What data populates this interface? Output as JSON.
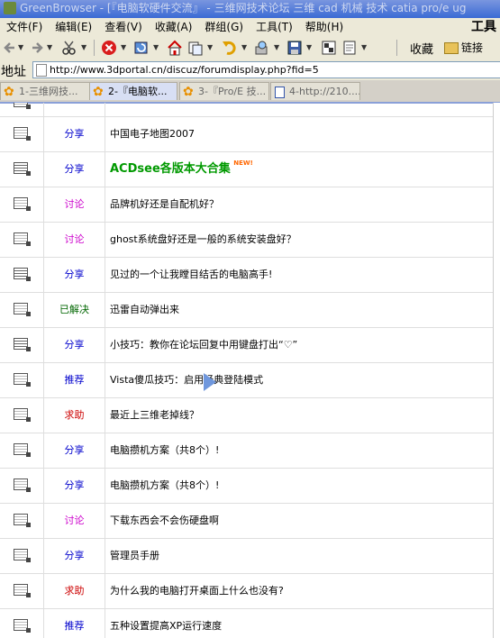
{
  "window": {
    "title": "GreenBrowser - [『电脑软硬件交流』 - 三维网技术论坛 三维 cad 机械 技术 catia pro/e ug"
  },
  "menu": {
    "items": [
      "文件(F)",
      "编辑(E)",
      "查看(V)",
      "收藏(A)",
      "群组(G)",
      "工具(T)",
      "帮助(H)"
    ],
    "tools_label": "工具"
  },
  "toolbar": {
    "favorites_label": "收藏",
    "links_label": "链接"
  },
  "address": {
    "label": "地址",
    "url": "http://www.3dportal.cn/discuz/forumdisplay.php?fid=5"
  },
  "tabs": [
    {
      "label": "1-三维网技...",
      "active": false,
      "icon": "flower-icon"
    },
    {
      "label": "2-『电脑软...",
      "active": true,
      "icon": "flower-icon"
    },
    {
      "label": "3-『Pro/E 技...",
      "active": false,
      "icon": "flower-icon"
    },
    {
      "label": "4-http://210....",
      "active": false,
      "icon": "page-icon"
    }
  ],
  "threads": [
    {
      "category": "分享",
      "cat": "share",
      "title": "中国电子地图2007",
      "icon": "doc-icon"
    },
    {
      "category": "分享",
      "cat": "share",
      "title": "ACDsee各版本大合集",
      "icon": "hot-doc-icon",
      "highlight": true,
      "badge": "NEW!"
    },
    {
      "category": "讨论",
      "cat": "discuss",
      "title": "品牌机好还是自配机好？",
      "icon": "doc-icon"
    },
    {
      "category": "讨论",
      "cat": "discuss",
      "title": "ghost系统盘好还是一般的系统安装盘好？",
      "icon": "doc-icon"
    },
    {
      "category": "分享",
      "cat": "share",
      "title": "见过的一个让我瞠目结舌的电脑高手!",
      "icon": "hot-doc-icon"
    },
    {
      "category": "已解决",
      "cat": "solved",
      "title": "迅雷自动弹出来",
      "icon": "doc-icon"
    },
    {
      "category": "分享",
      "cat": "share",
      "title": "小技巧：教你在论坛回复中用键盘打出“♡”",
      "icon": "hot-doc-icon"
    },
    {
      "category": "推荐",
      "cat": "share",
      "title": "Vista傻瓜技巧：启用经典登陆模式",
      "icon": "doc-icon"
    },
    {
      "category": "求助",
      "cat": "help",
      "title": "最近上三维老掉线？",
      "icon": "doc-icon"
    },
    {
      "category": "分享",
      "cat": "share",
      "title": "电脑攒机方案（共8个）!",
      "icon": "doc-icon"
    },
    {
      "category": "分享",
      "cat": "share",
      "title": "电脑攒机方案（共8个）!",
      "icon": "doc-icon"
    },
    {
      "category": "讨论",
      "cat": "discuss",
      "title": "下载东西会不会伤硬盘啊",
      "icon": "doc-icon"
    },
    {
      "category": "分享",
      "cat": "share",
      "title": "管理员手册",
      "icon": "doc-icon"
    },
    {
      "category": "求助",
      "cat": "help",
      "title": "为什么我的电脑打开桌面上什么也没有?",
      "icon": "doc-icon"
    },
    {
      "category": "推荐",
      "cat": "share",
      "title": "五种设置提高XP运行速度",
      "icon": "doc-icon"
    }
  ]
}
